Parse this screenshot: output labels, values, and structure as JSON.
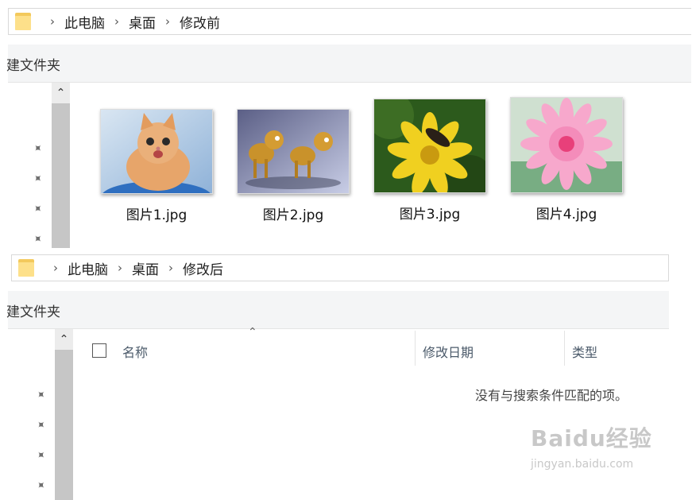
{
  "before": {
    "breadcrumb": [
      "此电脑",
      "桌面",
      "修改前"
    ],
    "command_text": "建文件夹",
    "files": [
      {
        "name": "图片1.jpg",
        "thumb": "kitten-photo"
      },
      {
        "name": "图片2.jpg",
        "thumb": "cartoon-horses"
      },
      {
        "name": "图片3.jpg",
        "thumb": "yellow-flower-bee"
      },
      {
        "name": "图片4.jpg",
        "thumb": "pink-dahlia"
      }
    ]
  },
  "after": {
    "breadcrumb": [
      "此电脑",
      "桌面",
      "修改后"
    ],
    "command_text": "建文件夹",
    "columns": [
      "名称",
      "修改日期",
      "类型"
    ],
    "empty_message": "没有与搜索条件匹配的项。"
  },
  "watermark": {
    "logo": "Baidu经验",
    "url": "jingyan.baidu.com"
  },
  "colors": {
    "folder": "#f3c95c",
    "scrollbar": "#c6c6c6",
    "toolbar_bg": "#f4f5f6"
  }
}
